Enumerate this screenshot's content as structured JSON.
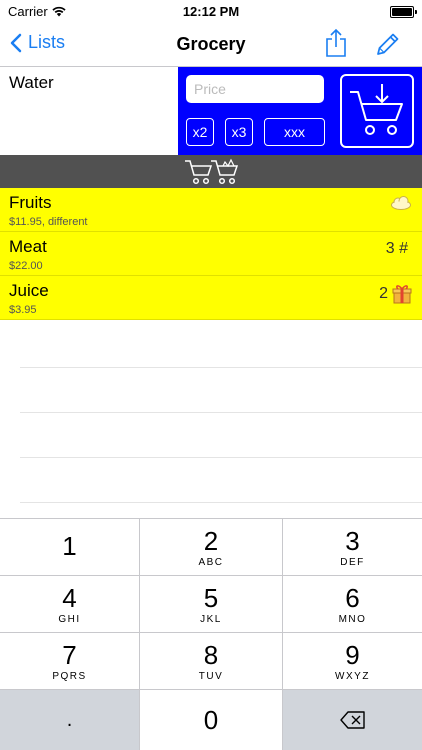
{
  "status": {
    "carrier": "Carrier",
    "time": "12:12 PM"
  },
  "nav": {
    "back_label": "Lists",
    "title": "Grocery"
  },
  "editor": {
    "item_name": "Water",
    "price_placeholder": "Price",
    "buttons": [
      "x2",
      "x3",
      "xxx"
    ]
  },
  "items": [
    {
      "name": "Fruits",
      "detail": "$11.95, different",
      "qty": "",
      "icon": "cloud-icon"
    },
    {
      "name": "Meat",
      "detail": "$22.00",
      "qty": "3 #",
      "icon": ""
    },
    {
      "name": "Juice",
      "detail": "$3.95",
      "qty": "2",
      "icon": "gift-icon"
    }
  ],
  "keypad": [
    {
      "digit": "1",
      "letters": ""
    },
    {
      "digit": "2",
      "letters": "ABC"
    },
    {
      "digit": "3",
      "letters": "DEF"
    },
    {
      "digit": "4",
      "letters": "GHI"
    },
    {
      "digit": "5",
      "letters": "JKL"
    },
    {
      "digit": "6",
      "letters": "MNO"
    },
    {
      "digit": "7",
      "letters": "PQRS"
    },
    {
      "digit": "8",
      "letters": "TUV"
    },
    {
      "digit": "9",
      "letters": "WXYZ"
    },
    {
      "digit": ".",
      "letters": ""
    },
    {
      "digit": "0",
      "letters": ""
    }
  ],
  "colors": {
    "accent": "#1a7ef2",
    "panel": "#0000ff",
    "row": "#ffff00",
    "bar": "#515151"
  }
}
